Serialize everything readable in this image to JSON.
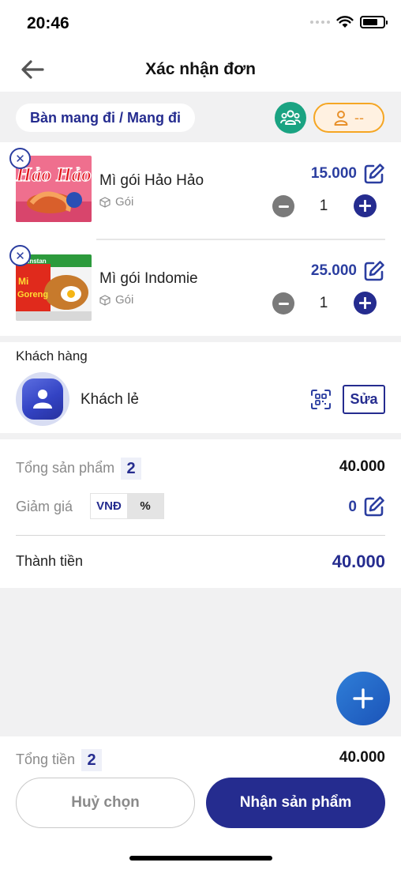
{
  "status_bar": {
    "time": "20:46"
  },
  "header": {
    "title": "Xác nhận đơn",
    "back_icon": "arrow-left-icon"
  },
  "table": {
    "label": "Bàn mang đi / Mang đi",
    "staff_label": "--"
  },
  "products": [
    {
      "name": "Mì gói Hảo Hảo",
      "unit": "Gói",
      "price": "15.000",
      "qty": "1",
      "image_text": "Hảo Hảo"
    },
    {
      "name": "Mì gói Indomie",
      "unit": "Gói",
      "price": "25.000",
      "qty": "1",
      "image_text": "Mi Instan Goreng"
    }
  ],
  "customer": {
    "heading": "Khách hàng",
    "name": "Khách lẻ",
    "edit_label": "Sửa"
  },
  "summary": {
    "total_products_label": "Tổng sản phẩm",
    "total_products_count": "2",
    "total_products_value": "40.000",
    "discount_label": "Giảm giá",
    "discount_units": [
      "VNĐ",
      "%"
    ],
    "discount_selected": "VNĐ",
    "discount_value": "0",
    "grand_total_label": "Thành tiền",
    "grand_total_value": "40.000"
  },
  "footer": {
    "total_label": "Tổng tiền",
    "total_count": "2",
    "total_value": "40.000",
    "cancel_label": "Huỷ chọn",
    "confirm_label": "Nhận sản phẩm"
  },
  "colors": {
    "primary": "#252c8f",
    "accent_green": "#1aa382",
    "accent_orange": "#f5a623",
    "fab": "#1b53b8"
  }
}
